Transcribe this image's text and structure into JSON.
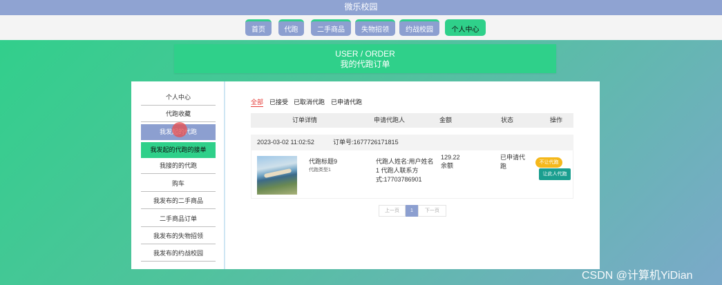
{
  "site": {
    "title": "微乐校园"
  },
  "nav": [
    {
      "label": "首页"
    },
    {
      "label": "代跑"
    },
    {
      "label": "二手商品"
    },
    {
      "label": "失物招领"
    },
    {
      "label": "约战校园"
    },
    {
      "label": "个人中心"
    }
  ],
  "banner": {
    "line1": "USER / ORDER",
    "line2": "我的代跑订单"
  },
  "sidebar": [
    {
      "label": "个人中心"
    },
    {
      "label": "代跑收藏"
    },
    {
      "label": "我发起的代跑"
    },
    {
      "label": "我发起的代跑的接单"
    },
    {
      "label": "我接的的代跑"
    },
    {
      "label": "购车"
    },
    {
      "label": "我发布的二手商品"
    },
    {
      "label": "二手商品订单"
    },
    {
      "label": "我发布的失物招领"
    },
    {
      "label": "我发布的约战校园"
    }
  ],
  "tabs": [
    {
      "label": "全部"
    },
    {
      "label": "已接受"
    },
    {
      "label": "已取消代跑"
    },
    {
      "label": "已申请代跑"
    }
  ],
  "table": {
    "headers": {
      "detail": "订单详情",
      "applicant": "申请代跑人",
      "amount": "金额",
      "status": "状态",
      "action": "操作"
    }
  },
  "order": {
    "datetime": "2023-03-02 11:02:52",
    "number_label": "订单号:1677726171815",
    "item_title": "代跑标题9",
    "item_type": "代跑类型1",
    "applicant_info": "代跑人姓名:用户姓名1 代跑人联系方式:17703786901",
    "amount": "129.22",
    "amount_unit": "余额",
    "status": "已申请代跑",
    "btn_reject": "不让代跑",
    "btn_accept": "让此人代跑"
  },
  "pagination": {
    "prev": "上一页",
    "current": "1",
    "next": "下一页"
  },
  "watermark": "CSDN @计算机YiDian",
  "colors": {
    "accent_green": "#2fd08a",
    "nav_blue": "#8c9fd0",
    "orange": "#f5b81b",
    "teal": "#1a9e8f"
  }
}
